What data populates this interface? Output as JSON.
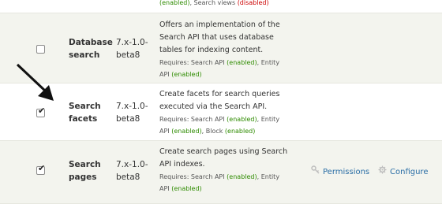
{
  "top_row": {
    "requires_tail": [
      "(enabled)",
      ", Search views ",
      "(disabled)"
    ]
  },
  "modules": [
    {
      "checked": false,
      "name_line1": "Database",
      "name_line2": "search",
      "version_line1": "7.x-1.0-",
      "version_line2": "beta8",
      "description_lines": [
        "Offers an implementation of the",
        "Search API that uses database",
        "tables for indexing content."
      ],
      "requires": {
        "prefix": "Requires: Search API ",
        "status1": "(enabled)",
        "middle": ", Entity",
        "line2_prefix": "API ",
        "status2": "(enabled)"
      }
    },
    {
      "checked": true,
      "name_line1": "Search",
      "name_line2": "facets",
      "version_line1": "7.x-1.0-",
      "version_line2": "beta8",
      "description_lines": [
        "Create facets for search queries",
        "executed via the Search API."
      ],
      "requires": {
        "prefix": "Requires: Search API ",
        "status1": "(enabled)",
        "middle": ", Entity",
        "line2_prefix": "API ",
        "status2": "(enabled)",
        "line2_mid": ", Block ",
        "status3": "(enabled)"
      }
    },
    {
      "checked": true,
      "name_line1": "Search",
      "name_line2": "pages",
      "version_line1": "7.x-1.0-",
      "version_line2": "beta8",
      "description_lines": [
        "Create search pages using Search",
        "API indexes."
      ],
      "requires": {
        "prefix": "Requires: Search API ",
        "status1": "(enabled)",
        "middle": ", Entity",
        "line2_prefix": "API ",
        "status2": "(enabled)"
      },
      "operations": {
        "permissions_label": "Permissions",
        "configure_label": "Configure"
      }
    }
  ],
  "icons": {
    "checkbox_mark": "✔",
    "permissions_icon": "key-icon",
    "configure_icon": "gear-icon"
  },
  "colors": {
    "enabled": "#2e8b00",
    "disabled": "#cc0000",
    "link": "#2a6ea6",
    "row_shade": "#f3f4ee"
  }
}
